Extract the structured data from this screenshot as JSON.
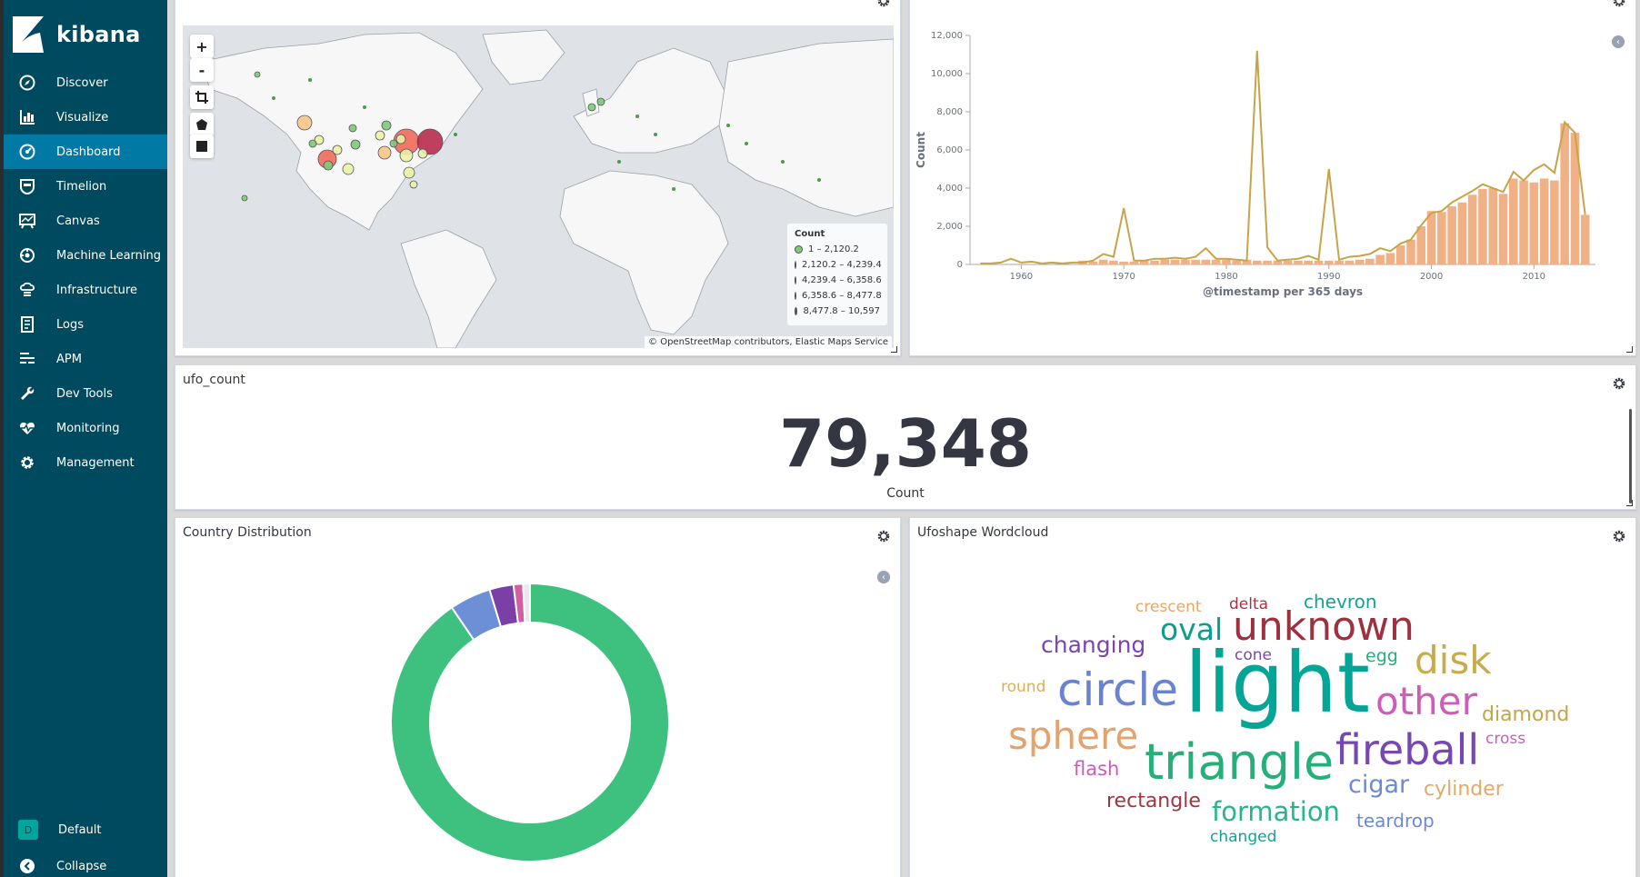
{
  "app": {
    "name": "kibana"
  },
  "nav": {
    "items": [
      {
        "label": "Discover",
        "icon": "compass-icon",
        "active": false
      },
      {
        "label": "Visualize",
        "icon": "bar-chart-icon",
        "active": false
      },
      {
        "label": "Dashboard",
        "icon": "dashboard-icon",
        "active": true
      },
      {
        "label": "Timelion",
        "icon": "timelion-icon",
        "active": false
      },
      {
        "label": "Canvas",
        "icon": "canvas-icon",
        "active": false
      },
      {
        "label": "Machine Learning",
        "icon": "machine-learning-icon",
        "active": false
      },
      {
        "label": "Infrastructure",
        "icon": "infrastructure-icon",
        "active": false
      },
      {
        "label": "Logs",
        "icon": "logs-icon",
        "active": false
      },
      {
        "label": "APM",
        "icon": "apm-icon",
        "active": false
      },
      {
        "label": "Dev Tools",
        "icon": "wrench-icon",
        "active": false
      },
      {
        "label": "Monitoring",
        "icon": "heartbeat-icon",
        "active": false
      },
      {
        "label": "Management",
        "icon": "gear-icon",
        "active": false
      }
    ],
    "space": {
      "badge": "D",
      "label": "Default"
    },
    "collapse_label": "Collapse"
  },
  "map": {
    "zoom_in": "+",
    "zoom_out": "-",
    "legend_title": "Count",
    "legend": [
      {
        "label": "1 – 2,120.2",
        "color": "#7ec87a"
      },
      {
        "label": "2,120.2 – 4,239.4",
        "color": "#eaf1a7"
      },
      {
        "label": "4,239.4 – 6,358.6",
        "color": "#f7c58a"
      },
      {
        "label": "6,358.6 – 8,477.8",
        "color": "#ee6a5c"
      },
      {
        "label": "8,477.8 – 10,597",
        "color": "#b82a4c"
      }
    ],
    "attribution": "© OpenStreetMap contributors, Elastic Maps Service"
  },
  "chart_data": {
    "type": "bar",
    "xlabel": "@timestamp per 365 days",
    "ylabel": "Count",
    "ylim": [
      0,
      12000
    ],
    "xlim": [
      1955,
      2016
    ],
    "yticks": [
      "0",
      "2,000",
      "4,000",
      "6,000",
      "8,000",
      "10,000",
      "12,000"
    ],
    "xticks": [
      "1960",
      "1970",
      "1980",
      "1990",
      "2000",
      "2010"
    ],
    "bars": {
      "x": [
        1966,
        1967,
        1968,
        1969,
        1970,
        1971,
        1972,
        1973,
        1974,
        1975,
        1976,
        1977,
        1978,
        1979,
        1980,
        1981,
        1982,
        1983,
        1984,
        1985,
        1986,
        1987,
        1988,
        1989,
        1990,
        1991,
        1992,
        1993,
        1994,
        1995,
        1996,
        1997,
        1998,
        1999,
        2000,
        2001,
        2002,
        2003,
        2004,
        2005,
        2006,
        2007,
        2008,
        2009,
        2010,
        2011,
        2012,
        2013,
        2014,
        2015
      ],
      "y": [
        200,
        150,
        250,
        200,
        150,
        150,
        200,
        200,
        250,
        250,
        250,
        250,
        250,
        250,
        250,
        200,
        250,
        200,
        200,
        200,
        200,
        200,
        200,
        200,
        200,
        200,
        200,
        250,
        300,
        500,
        600,
        1000,
        1300,
        2000,
        2800,
        2750,
        3050,
        3250,
        3650,
        3950,
        4000,
        3700,
        4500,
        4400,
        4300,
        4500,
        4400,
        7400,
        6900,
        2600
      ]
    },
    "line": {
      "x": [
        1956,
        1957,
        1958,
        1959,
        1960,
        1961,
        1962,
        1963,
        1964,
        1965,
        1966,
        1967,
        1968,
        1969,
        1970,
        1971,
        1972,
        1973,
        1974,
        1975,
        1976,
        1977,
        1978,
        1979,
        1980,
        1981,
        1982,
        1983,
        1984,
        1985,
        1986,
        1987,
        1988,
        1989,
        1990,
        1991,
        1992,
        1993,
        1994,
        1995,
        1996,
        1997,
        1998,
        1999,
        2000,
        2001,
        2002,
        2003,
        2004,
        2005,
        2006,
        2007,
        2008,
        2009,
        2010,
        2011,
        2012,
        2013,
        2014,
        2015
      ],
      "y": [
        50,
        50,
        100,
        300,
        100,
        150,
        50,
        100,
        50,
        100,
        100,
        200,
        550,
        400,
        2950,
        200,
        200,
        300,
        300,
        350,
        300,
        400,
        850,
        300,
        300,
        250,
        200,
        11200,
        900,
        200,
        250,
        300,
        450,
        250,
        5000,
        250,
        400,
        450,
        550,
        850,
        700,
        1100,
        1300,
        2050,
        2700,
        2800,
        3250,
        3550,
        3850,
        4200,
        4000,
        3800,
        4850,
        4400,
        4950,
        5250,
        4800,
        7450,
        6900,
        2600
      ]
    }
  },
  "metric": {
    "title": "ufo_count",
    "value": "79,348",
    "label": "Count"
  },
  "country": {
    "title": "Country Distribution",
    "slices": [
      {
        "value": 90.5,
        "color": "#3ec07e"
      },
      {
        "value": 4.8,
        "color": "#6c8fd6"
      },
      {
        "value": 2.8,
        "color": "#7b3fa8"
      },
      {
        "value": 1.1,
        "color": "#d35fa3"
      },
      {
        "value": 0.8,
        "color": "#e9e9e9"
      }
    ]
  },
  "wordcloud": {
    "title": "Ufoshape Wordcloud",
    "words": [
      {
        "text": "light",
        "color": "#04a596"
      },
      {
        "text": "unknown",
        "color": "#9e3140"
      },
      {
        "text": "triangle",
        "color": "#25b07a"
      },
      {
        "text": "circle",
        "color": "#6a83d0"
      },
      {
        "text": "fireball",
        "color": "#7649b0"
      },
      {
        "text": "other",
        "color": "#cc5db8"
      },
      {
        "text": "sphere",
        "color": "#e2a36e"
      },
      {
        "text": "disk",
        "color": "#c8ac4b"
      },
      {
        "text": "oval",
        "color": "#0e9c8d"
      },
      {
        "text": "formation",
        "color": "#28b58d"
      },
      {
        "text": "changing",
        "color": "#7a46ad"
      },
      {
        "text": "cigar",
        "color": "#6c8ad4"
      },
      {
        "text": "cylinder",
        "color": "#e3a969"
      },
      {
        "text": "diamond",
        "color": "#c4a548"
      },
      {
        "text": "rectangle",
        "color": "#a03642"
      },
      {
        "text": "teardrop",
        "color": "#6c8ad4"
      },
      {
        "text": "chevron",
        "color": "#13a394"
      },
      {
        "text": "flash",
        "color": "#cc5db8"
      },
      {
        "text": "crescent",
        "color": "#e4a66a"
      },
      {
        "text": "delta",
        "color": "#a53444"
      },
      {
        "text": "egg",
        "color": "#25b07a"
      },
      {
        "text": "cone",
        "color": "#7649b0"
      },
      {
        "text": "round",
        "color": "#d8b05a"
      },
      {
        "text": "cross",
        "color": "#cc5db8"
      },
      {
        "text": "changed",
        "color": "#13a394"
      }
    ]
  }
}
